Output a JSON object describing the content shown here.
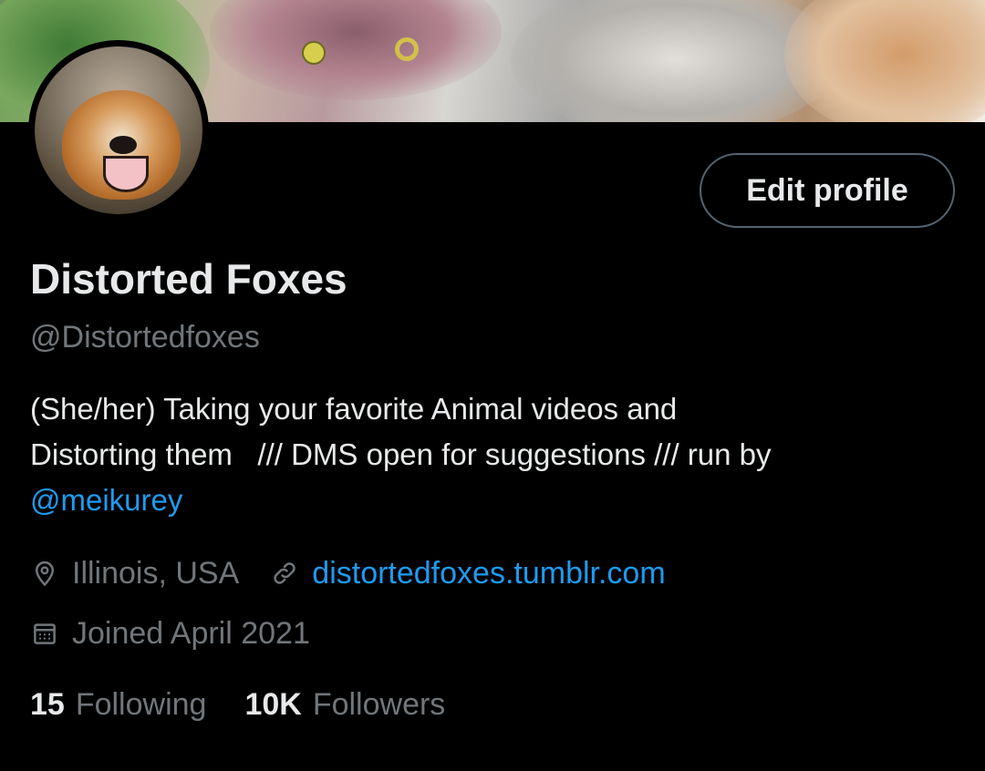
{
  "profile": {
    "display_name": "Distorted Foxes",
    "handle": "@Distortedfoxes",
    "bio_line1": "(She/her) Taking your favorite Animal videos and",
    "bio_line2": "Distorting them   /// DMS open for suggestions /// run by",
    "bio_mention": "@meikurey",
    "location": "Illinois, USA",
    "website": "distortedfoxes.tumblr.com",
    "joined": "Joined April 2021"
  },
  "actions": {
    "edit_profile_label": "Edit profile"
  },
  "stats": {
    "following_count": "15",
    "following_label": "Following",
    "followers_count": "10K",
    "followers_label": "Followers"
  },
  "icons": {
    "location": "map-pin-icon",
    "website": "link-icon",
    "joined": "calendar-icon"
  },
  "colors": {
    "background": "#000000",
    "primary_text": "#e7e9ea",
    "secondary_text": "#71767b",
    "link": "#1d9bf0",
    "button_border": "#536471"
  }
}
